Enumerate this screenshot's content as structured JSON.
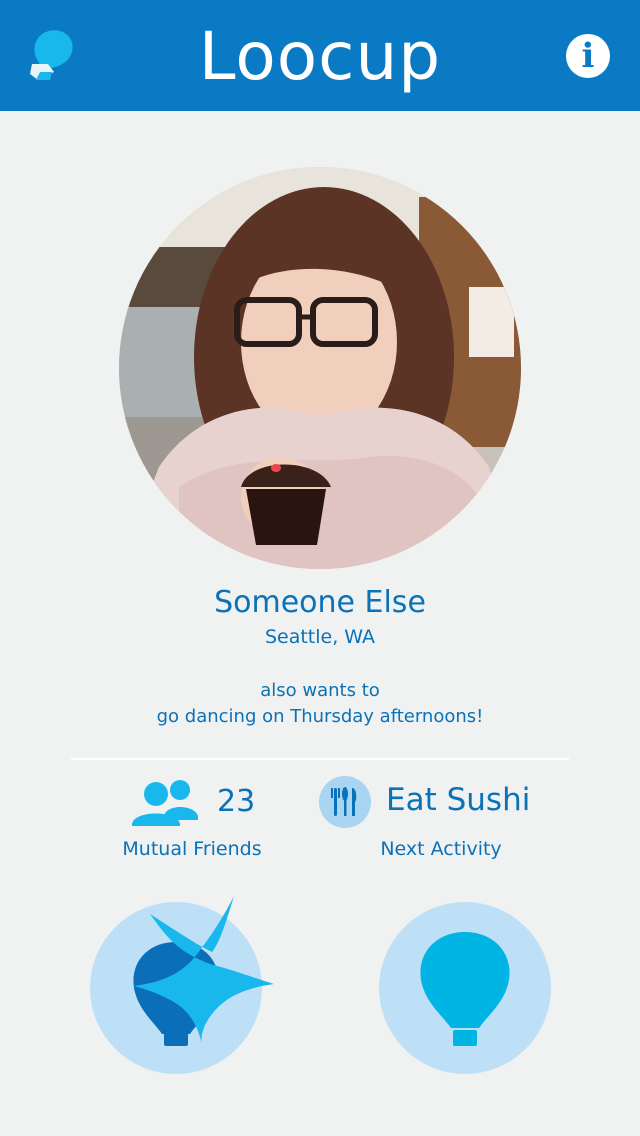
{
  "header": {
    "title": "Loocup",
    "info_glyph": "i",
    "logo_icon": "balloon-logo-icon",
    "info_icon": "info-icon"
  },
  "profile": {
    "name": "Someone Else",
    "location": "Seattle, WA",
    "message_line1": "also wants to",
    "message_line2": "go dancing on Thursday afternoons!"
  },
  "stats": {
    "mutual_friends_count": "23",
    "mutual_friends_label": "Mutual Friends",
    "next_activity": "Eat Sushi",
    "next_activity_label": "Next Activity",
    "friends_icon": "people-icon",
    "activity_icon": "utensils-icon"
  },
  "actions": {
    "boost_icon": "sparkle-balloon-icon",
    "go_icon": "balloon-icon"
  },
  "colors": {
    "header_bg": "#0a7ac4",
    "accent": "#0a72b8",
    "light_blue": "#bde0f7",
    "cyan": "#00b4e3",
    "page_bg": "#f0f1f1"
  }
}
